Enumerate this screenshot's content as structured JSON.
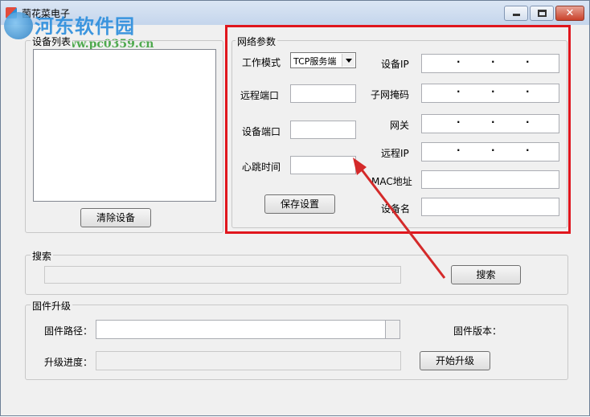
{
  "window": {
    "title": "菌花菜电子"
  },
  "watermark": {
    "name": "河东软件园",
    "url": "www.pc0359.cn"
  },
  "device_list": {
    "legend": "设备列表",
    "items": [],
    "clear_button": "清除设备"
  },
  "network": {
    "legend": "网络参数",
    "work_mode_label": "工作模式",
    "work_mode_value": "TCP服务端",
    "remote_port_label": "远程端口",
    "remote_port_value": "",
    "device_port_label": "设备端口",
    "device_port_value": "",
    "heartbeat_label": "心跳时间",
    "heartbeat_value": "",
    "save_button": "保存设置",
    "device_ip_label": "设备IP",
    "subnet_mask_label": "子网掩码",
    "gateway_label": "网关",
    "remote_ip_label": "远程IP",
    "mac_label": "MAC地址",
    "mac_value": "",
    "device_name_label": "设备名",
    "device_name_value": ""
  },
  "search": {
    "legend": "搜索",
    "button": "搜索"
  },
  "firmware": {
    "legend": "固件升级",
    "path_label": "固件路径：",
    "path_value": "",
    "version_label": "固件版本：",
    "progress_label": "升级进度：",
    "progress": 0,
    "start_button": "开始升级"
  },
  "annotation": {
    "highlight_color": "#e0161d",
    "arrow_color": "#d42a2a"
  }
}
